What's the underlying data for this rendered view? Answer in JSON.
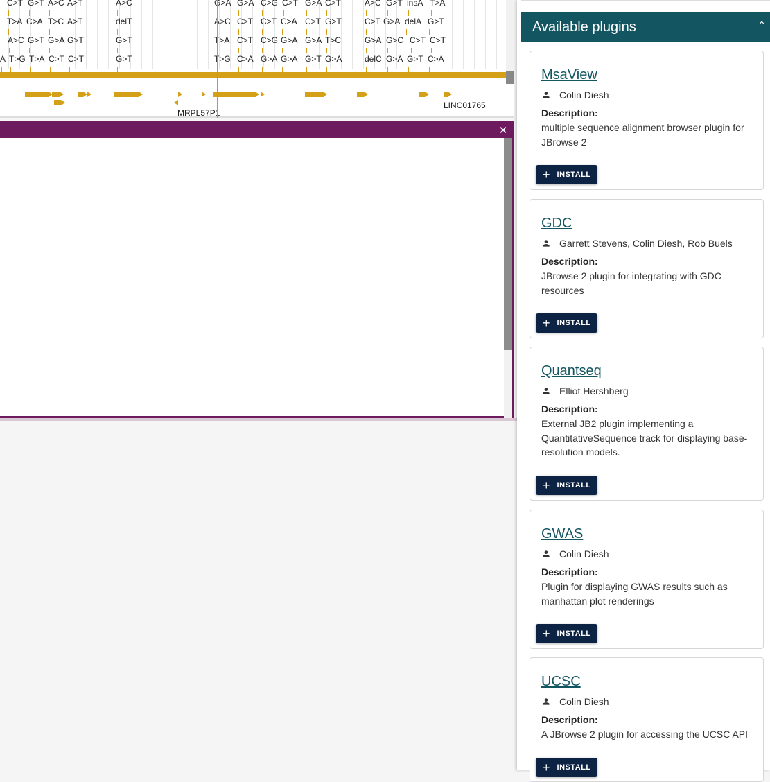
{
  "track": {
    "variants": [
      [
        "C>T",
        "G>T",
        "A>C",
        "A>T",
        "A>C",
        "G>A",
        "G>A",
        "C>G",
        "C>T",
        "G>A",
        "C>T",
        "A>C",
        "G>T",
        "insA",
        "T>A"
      ],
      [
        "T>A",
        "C>A",
        "T>C",
        "A>T",
        "delT",
        "A>C",
        "C>T",
        "C>T",
        "C>A",
        "C>T",
        "G>T",
        "C>T",
        "G>A",
        "delA",
        "G>T"
      ],
      [
        "A>C",
        "G>T",
        "G>A",
        "G>T",
        "G>T",
        "T>A",
        "C>T",
        "C>G",
        "G>A",
        "G>A",
        "T>C",
        "G>A",
        "G>C",
        "C>T",
        "C>T"
      ],
      [
        "A",
        "T>G",
        "T>A",
        "C>T",
        "C>T",
        "G>T",
        "T>G",
        "C>A",
        "G>A",
        "G>A",
        "G>T",
        "G>A",
        "delC",
        "G>A",
        "G>T",
        "C>A"
      ]
    ],
    "genes": [
      "MRPL57P1",
      "LINC01765"
    ]
  },
  "widget": {
    "close_label": "✕"
  },
  "drawer": {
    "title": "Available plugins",
    "collapse_glyph": "⌃",
    "description_label": "Description:",
    "install_label": "INSTALL",
    "install_plus": "+",
    "plugins": [
      {
        "name": "MsaView",
        "authors": "Colin Diesh",
        "description": "multiple sequence alignment browser plugin for JBrowse 2"
      },
      {
        "name": "GDC",
        "authors": "Garrett Stevens, Colin Diesh, Rob Buels",
        "description": "JBrowse 2 plugin for integrating with GDC resources"
      },
      {
        "name": "Quantseq",
        "authors": "Elliot Hershberg",
        "description": "External JB2 plugin implementing a QuantitativeSequence track for displaying base-resolution models."
      },
      {
        "name": "GWAS",
        "authors": "Colin Diesh",
        "description": "Plugin for displaying GWAS results such as manhattan plot renderings"
      },
      {
        "name": "UCSC",
        "authors": "Colin Diesh",
        "description": "A JBrowse 2 plugin for accessing the UCSC API"
      }
    ]
  }
}
